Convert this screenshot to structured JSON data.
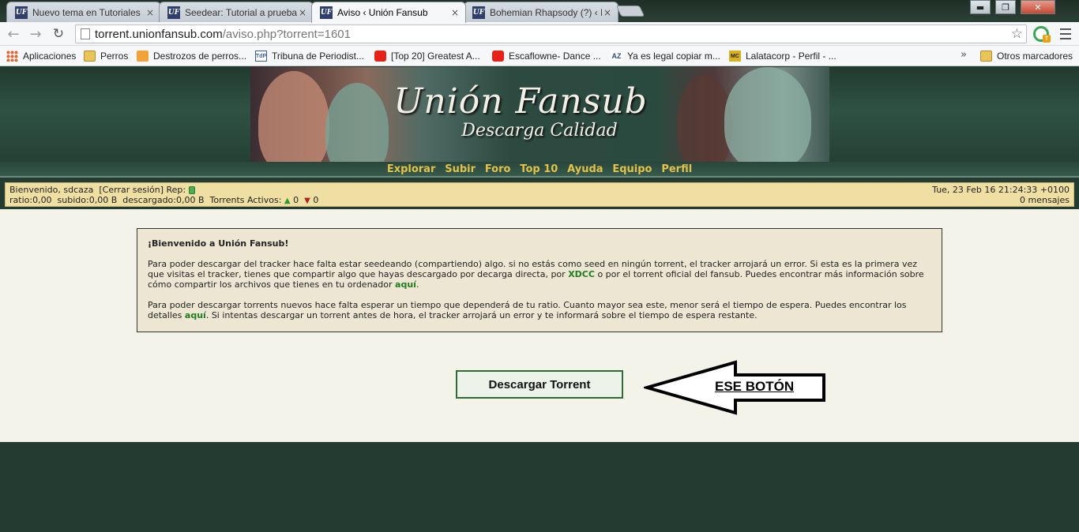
{
  "browser": {
    "tabs": [
      {
        "favicon": "UF",
        "title": "Nuevo tema en Tutoriales",
        "close": "×",
        "active": false
      },
      {
        "favicon": "UF",
        "title": "Seedear: Tutorial a prueba",
        "close": "×",
        "active": false
      },
      {
        "favicon": "UF",
        "title": "Aviso ‹ Unión Fansub",
        "close": "×",
        "active": true
      },
      {
        "favicon": "UF",
        "title": "Bohemian Rhapsody (?) ‹ D",
        "close": "×",
        "active": false
      }
    ],
    "url": {
      "host": "torrent.unionfansub.com",
      "path": "/aviso.php?torrent=1601"
    },
    "window_controls": {
      "minimize": "▬",
      "restore": "❐",
      "close": "✕"
    },
    "bookmarks": [
      {
        "icon": "apps-icon",
        "label": "Aplicaciones"
      },
      {
        "icon": "folder-icon",
        "label": "Perros"
      },
      {
        "icon": "orange-page-icon",
        "label": "Destrozos de perros..."
      },
      {
        "icon": "tdp-icon",
        "icon_text": "TdP",
        "label": "Tribuna de Periodist..."
      },
      {
        "icon": "youtube-icon",
        "label": "[Top 20] Greatest A..."
      },
      {
        "icon": "youtube-icon",
        "label": "Escaflowne- Dance ..."
      },
      {
        "icon": "az-icon",
        "icon_text": "AZ",
        "label": "Ya es legal copiar m..."
      },
      {
        "icon": "mc-icon",
        "icon_text": "MC",
        "label": "Lalatacorp - Perfil - ..."
      }
    ],
    "bookmarks_overflow": "»",
    "other_bookmarks": "Otros marcadores"
  },
  "site": {
    "title": "Unión Fansub",
    "subtitle": "Descarga Calidad",
    "nav": [
      "Explorar",
      "Subir",
      "Foro",
      "Top 10",
      "Ayuda",
      "Equipo",
      "Perfil"
    ],
    "userbar": {
      "welcome": "Bienvenido, sdcaza",
      "logout": "[Cerrar sesión]",
      "rep_label": "Rep:",
      "stats": "ratio:0,00  subido:0,00 B  descargado:0,00 B  Torrents Activos:",
      "seeding": "0",
      "leeching": "0",
      "datetime": "Tue, 23 Feb 16 21:24:33 +0100",
      "messages": "0 mensajes"
    },
    "notice": {
      "heading": "¡Bienvenido a Unión Fansub!",
      "p1_a": "Para poder descargar del tracker hace falta estar seedeando (compartiendo) algo. si no estás como seed en ningún torrent, el tracker arrojará un error. Si esta es la primera vez que visitas el tracker, tienes que compartir algo que hayas descargado por decarga directa, por ",
      "p1_link1": "XDCC",
      "p1_b": " o por el torrent oficial del fansub. Puedes encontrar más información sobre cómo compartir los archivos que tienes en tu ordenador ",
      "p1_link2": "aquí",
      "p1_c": ".",
      "p2_a": "Para poder descargar torrents nuevos hace falta esperar un tiempo que dependerá de tu ratio. Cuanto mayor sea este, menor será el tiempo de espera. Puedes encontrar los detalles ",
      "p2_link": "aquí",
      "p2_b": ". Si intentas descargar un torrent antes de hora, el tracker arrojará un error y te informará sobre el tiempo de espera restante."
    },
    "download_button": "Descargar Torrent",
    "annotation": "ESE BOTÓN"
  }
}
